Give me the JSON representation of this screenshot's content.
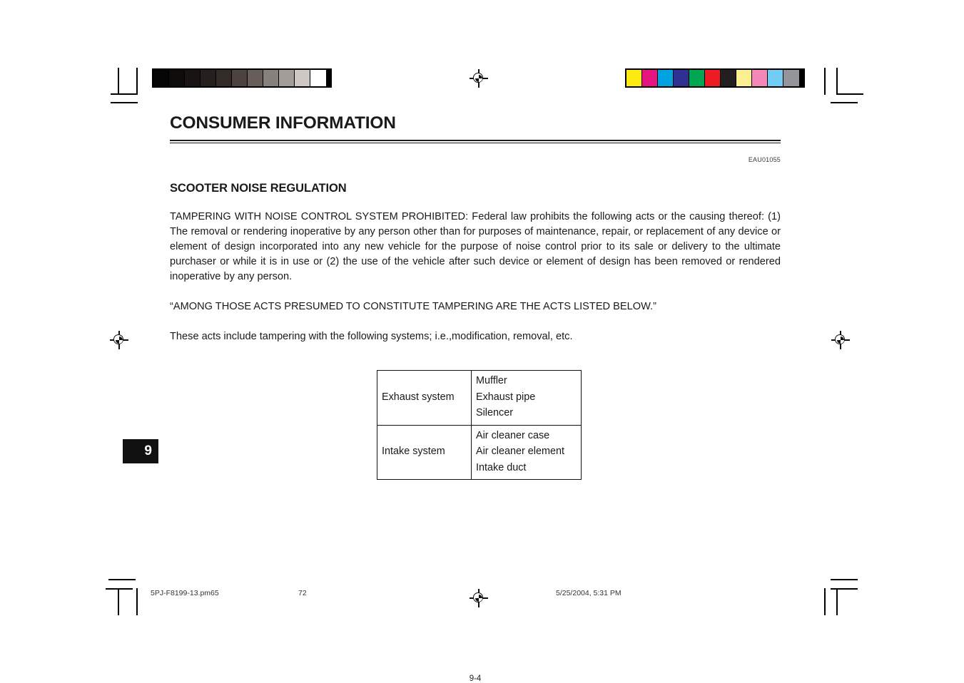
{
  "document": {
    "title": "CONSUMER INFORMATION",
    "reference_code": "EAU01055",
    "section_heading": "SCOOTER NOISE REGULATION",
    "paragraphs": {
      "main": "TAMPERING WITH NOISE CONTROL SYSTEM PROHIBITED: Federal law prohibits the following acts or the causing thereof: (1) The removal or rendering inoperative by any person other than for purposes of maintenance, repair, or replacement of any device or element of design incorporated into any new vehicle for the purpose of noise control prior to its sale or delivery to the ultimate purchaser or while it is in use or (2) the use of the vehicle after such device or element of design has been removed or rendered inoperative by any person.",
      "quote": "“AMONG THOSE ACTS PRESUMED TO CONSTITUTE TAMPERING ARE THE ACTS LISTED BELOW.”",
      "tail": "These acts include tampering with the following systems; i.e.,modification, removal, etc."
    },
    "table": {
      "rows": [
        {
          "system": "Exhaust system",
          "parts": "Muffler\nExhaust pipe\nSilencer"
        },
        {
          "system": "Intake system",
          "parts": "Air cleaner case\nAir cleaner element\nIntake duct"
        }
      ]
    },
    "chapter_tab": "9",
    "page_number": "9-4",
    "print_footer": {
      "file": "5PJ-F8199-13.pm65",
      "sheet": "72",
      "timestamp": "5/25/2004, 5:31 PM"
    }
  },
  "press_marks": {
    "grayscale_strip": {
      "name": "grayscale-calibration-strip",
      "colors": [
        "#050505",
        "#0e0b0b",
        "#191414",
        "#261f1d",
        "#332b28",
        "#4c423e",
        "#685e59",
        "#87807c",
        "#a39c98",
        "#cfc7c4",
        "#ffffff"
      ]
    },
    "color_strip": {
      "name": "process-color-calibration-strip",
      "colors": [
        "#fcea10",
        "#e6157f",
        "#00a3e0",
        "#2e3192",
        "#00a651",
        "#ed1c24",
        "#231f20",
        "#fbef92",
        "#f489b9",
        "#72cdf4",
        "#939598"
      ]
    },
    "registration_targets": 4,
    "crop_marks": 4
  }
}
